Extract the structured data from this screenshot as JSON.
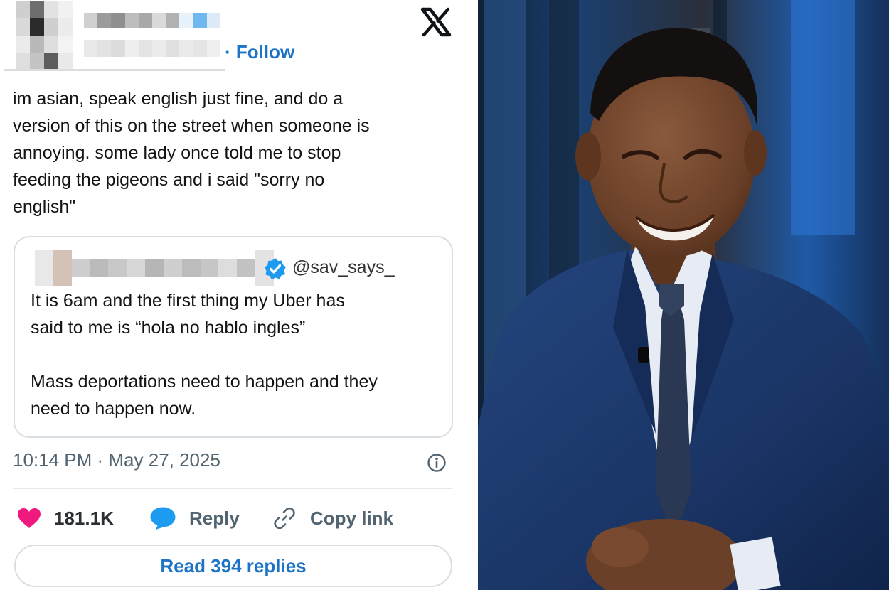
{
  "tweet": {
    "follow_label": "Follow",
    "body_lines": [
      "im asian, speak english just fine, and do a",
      "version of this on the street when someone is",
      "annoying. some lady once told me to stop",
      "feeding the pigeons and i said \"sorry no",
      "english\""
    ],
    "quote": {
      "handle": "@sav_says_",
      "lines": [
        "It is 6am and the first thing my Uber has",
        "said to me is “hola no hablo ingles”"
      ],
      "lines2": [
        "Mass deportations need to happen and they",
        "need to happen now."
      ]
    },
    "timestamp": "10:14 PM · May 27, 2025",
    "likes": "181.1K",
    "reply_label": "Reply",
    "copy_link_label": "Copy link",
    "read_replies_label": "Read 394 replies"
  },
  "icons": {
    "logo": "x-logo-icon",
    "verified": "verified-badge-icon",
    "info": "info-icon",
    "like": "heart-icon",
    "reply": "speech-bubble-icon",
    "copy": "link-icon"
  },
  "colors": {
    "accent_blue": "#1d74c6",
    "like_pink": "#f0197d",
    "reply_blue": "#1d9bf0",
    "muted_gray": "#536471",
    "suit_navy": "#1c3766"
  }
}
